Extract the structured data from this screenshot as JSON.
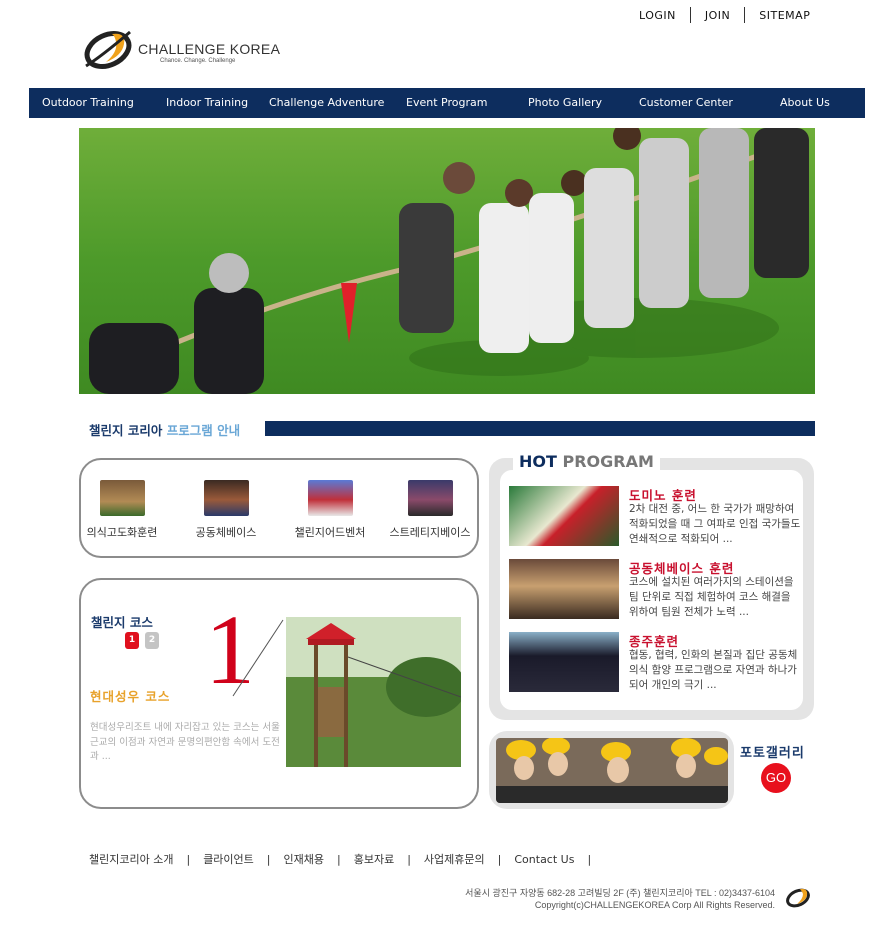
{
  "top_links": [
    "LOGIN",
    "JOIN",
    "SITEMAP"
  ],
  "brand": {
    "name": "CHALLENGE KOREA",
    "tagline": "Chance. Change. Challenge"
  },
  "nav": [
    "Outdoor Training",
    "Indoor Training",
    "Challenge Adventure",
    "Event Program",
    "Photo Gallery",
    "Customer Center",
    "About Us"
  ],
  "program_intro": {
    "title_main": "챌린지 코리아",
    "title_sub": "프로그램 안내"
  },
  "categories": [
    "의식고도화훈련",
    "공동체베이스",
    "챌린지어드벤처",
    "스트레티지베이스"
  ],
  "course": {
    "heading": "챌린지 코스",
    "pages": [
      "1",
      "2"
    ],
    "big_number": "1",
    "name": "현대성우 코스",
    "description": "현대성우리조트 내에 자리잡고 있는 코스는 서울 근교의 이점과 자연과 문명의편안함 속에서 도전과 ..."
  },
  "hot_program": {
    "title_hot": "HOT",
    "title_program": "PROGRAM",
    "items": [
      {
        "name": "도미노 훈련",
        "desc": "2차 대전 중, 어느 한 국가가 패망하여 적화되었을 때 그 여파로 인접 국가들도 연쇄적으로 적화되어 ..."
      },
      {
        "name": "공동체베이스 훈련",
        "desc": "코스에 설치된 여러가지의 스테이션을 팀 단위로 직접 체험하여 코스 해결을 위하여 팀원 전체가 노력 ..."
      },
      {
        "name": "종주훈련",
        "desc": "협동, 협력, 인화의 본질과 집단 공동체 의식 함양 프로그램으로 자연과 하나가 되어 개인의 극기 ..."
      }
    ]
  },
  "gallery": {
    "label": "포토갤러리",
    "go": "GO"
  },
  "footer": {
    "links": [
      "챌린지코리아 소개",
      "클라이언트",
      "인재채용",
      "홍보자료",
      "사업제휴문의",
      "Contact Us"
    ],
    "address": "서울시 광진구 자양동 682-28 고려빌딩 2F (주) 챌린지코리아 TEL : 02)3437-6104",
    "copyright": "Copyright(c)CHALLENGEKOREA Corp All Rights Reserved."
  },
  "colors": {
    "nav_bg": "#0d2d5e",
    "accent_red": "#c8102e",
    "accent_orange": "#e8a22b"
  }
}
